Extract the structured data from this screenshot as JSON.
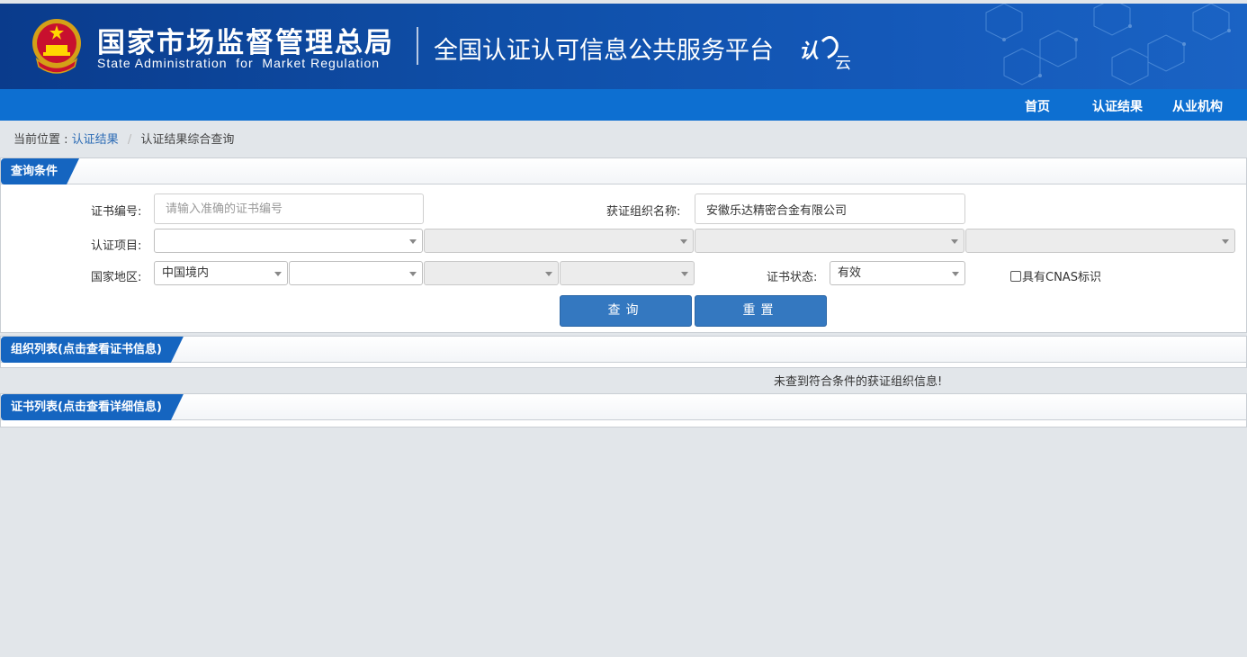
{
  "header": {
    "agency_cn": "国家市场监督管理总局",
    "agency_en": "State Administration  for  Market Regulation",
    "platform_title": "全国认证认可信息公共服务平台",
    "cloud_logo_text": "认云"
  },
  "nav": {
    "items": [
      {
        "label": "首页"
      },
      {
        "label": "认证结果"
      },
      {
        "label": "从业机构"
      }
    ]
  },
  "breadcrumb": {
    "prefix": "当前位置 :",
    "link": "认证结果",
    "separator": "/",
    "current": "认证结果综合查询"
  },
  "query_panel": {
    "title": "查询条件",
    "cert_no_label": "证书编号:",
    "cert_no_placeholder": "请输入准确的证书编号",
    "org_name_label": "获证组织名称:",
    "org_name_value": "安徽乐达精密合金有限公司",
    "project_label": "认证项目:",
    "region_label": "国家地区:",
    "region_value": "中国境内",
    "status_label": "证书状态:",
    "status_value": "有效",
    "cnas_label": "具有CNAS标识",
    "query_button": "查询",
    "reset_button": "重置"
  },
  "org_panel": {
    "title": "组织列表(点击查看证书信息)",
    "empty_message": "未查到符合条件的获证组织信息!"
  },
  "cert_panel": {
    "title": "证书列表(点击查看详细信息)"
  },
  "colors": {
    "banner": "#0f4fa8",
    "navbar": "#0d6fd1",
    "tab": "#1565c0",
    "button": "#3478c0",
    "page_bg": "#e2e6ea"
  }
}
